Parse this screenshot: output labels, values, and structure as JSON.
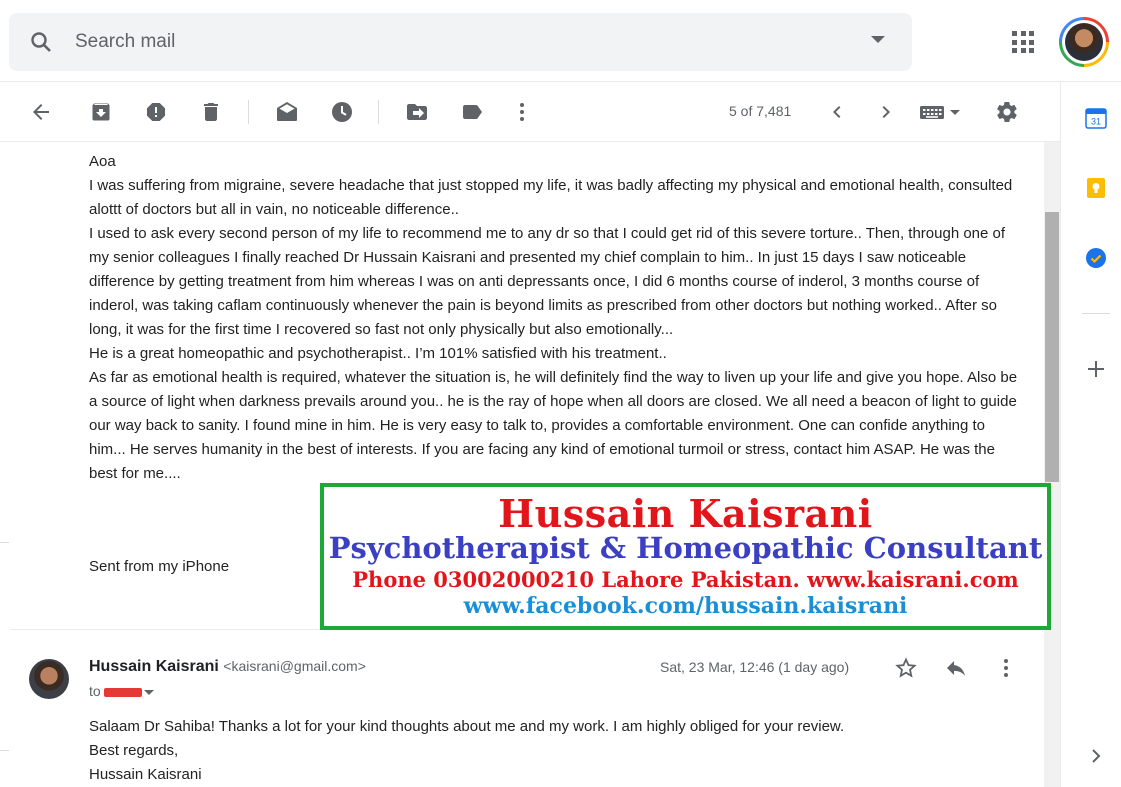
{
  "search": {
    "placeholder": "Search mail",
    "icon": "search-icon"
  },
  "header": {
    "apps_icon": "apps-grid-icon",
    "avatar": "account-avatar"
  },
  "toolbar": {
    "buttons": [
      "back-arrow-icon",
      "archive-icon",
      "report-spam-icon",
      "delete-icon",
      "mark-unread-icon",
      "snooze-icon",
      "move-to-icon",
      "label-icon",
      "more-vert-icon"
    ],
    "counter": "5 of 7,481",
    "settings_icon": "gear-icon",
    "keyboard_icon": "keyboard-icon"
  },
  "message": {
    "lines": [
      "Aoa",
      "I was suffering from migraine, severe headache that just stopped my life, it was badly affecting my physical and emotional health, consulted alottt of doctors but all in vain, no noticeable difference..",
      "I used to ask every second person of my life to recommend me to any dr so that I could get rid of this severe torture.. Then, through one of my senior colleagues I finally reached Dr Hussain Kaisrani and presented my chief complain to him.. In just 15 days I saw noticeable difference by getting treatment from him whereas I was on anti depressants once, I did 6 months course of inderol, 3 months course of inderol, was taking caflam continuously whenever the pain is beyond limits as prescribed from other doctors but nothing worked.. After so long, it was for the first time I recovered so fast not only physically but also emotionally...",
      "He is a great homeopathic and psychotherapist.. I’m 101% satisfied with his treatment..",
      "As far as emotional health is required, whatever the situation is, he will definitely find the way to liven up your life and give you hope. Also be a source of light when darkness prevails around you.. he is the ray of hope when all doors are closed. We all need a beacon of light to guide our way back to sanity. I found mine in him. He is very easy to talk to, provides a comfortable environment. One can confide anything to him... He serves humanity in the best of interests. If you are facing any kind of emotional turmoil or stress, contact him ASAP. He was the best for me...."
    ],
    "sent_from": "Sent from my iPhone"
  },
  "banner": {
    "name": "Hussain Kaisrani",
    "title": "Psychotherapist & Homeopathic Consultant",
    "contact": "Phone 03002000210 Lahore Pakistan.  www.kaisrani.com",
    "facebook": "www.facebook.com/hussain.kaisrani",
    "colors": {
      "border": "#1fa83a",
      "red": "#e2151b",
      "blue": "#3b3fc2",
      "cyan": "#1a8fd6"
    }
  },
  "reply": {
    "sender_name": "Hussain Kaisrani",
    "sender_email": "<kaisrani@gmail.com>",
    "to_label": "to",
    "date": "Sat, 23 Mar, 12:46 (1 day ago)",
    "lines": [
      "Salaam Dr Sahiba! Thanks a lot for your kind thoughts about me and my work. I am highly obliged for your review.",
      "Best regards,",
      "Hussain Kaisrani"
    ]
  },
  "sidepanel": [
    "calendar-icon",
    "keep-icon",
    "tasks-icon",
    "add-icon",
    "chevron-right-icon"
  ]
}
